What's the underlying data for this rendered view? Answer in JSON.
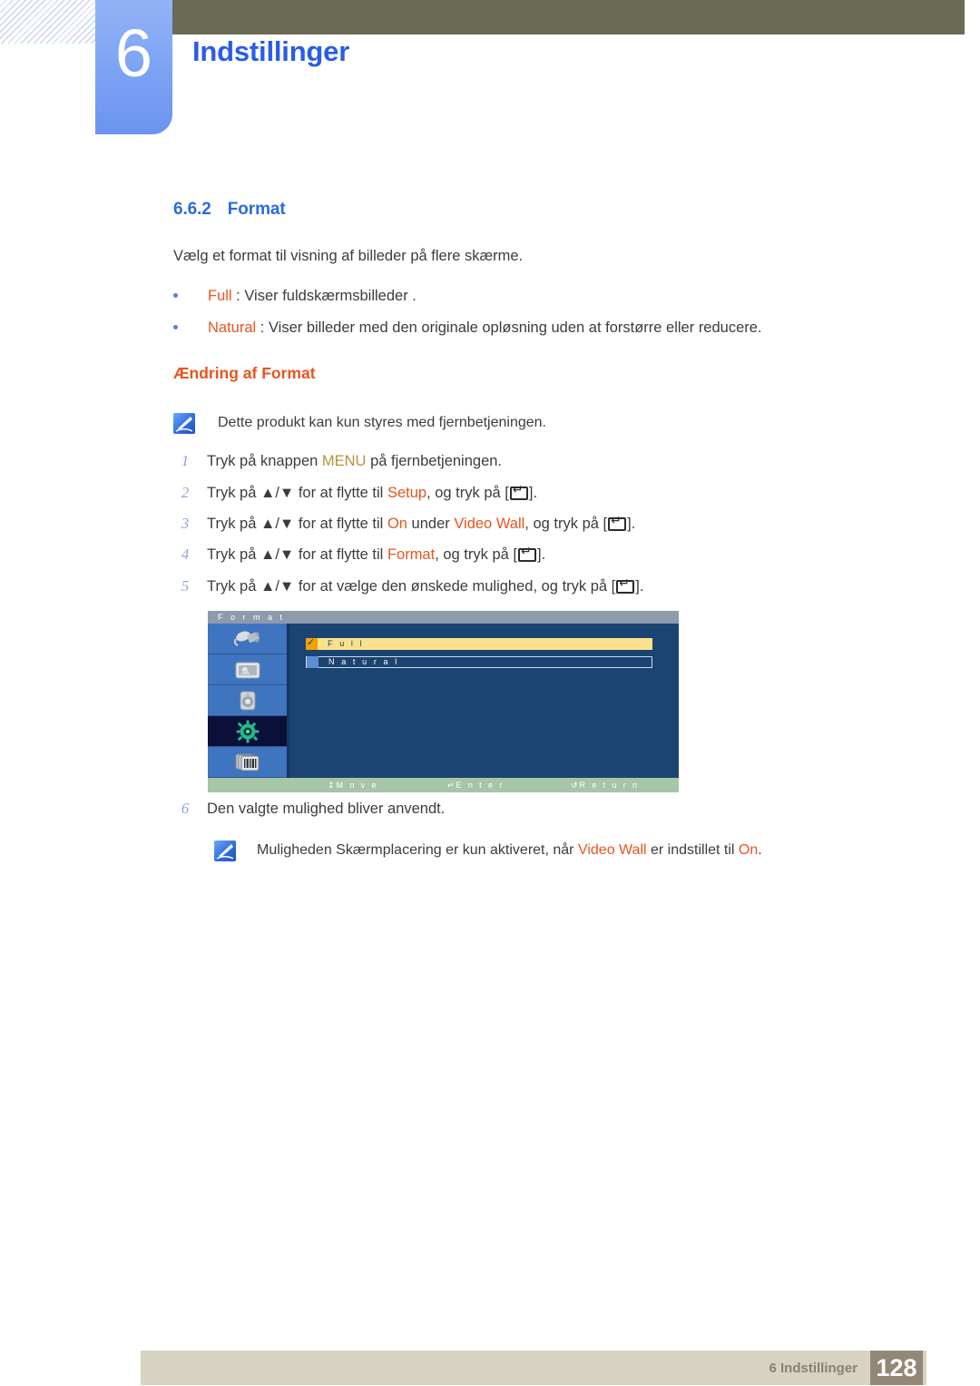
{
  "header": {
    "chapter_number": "6",
    "chapter_title": "Indstillinger"
  },
  "section": {
    "number": "6.6.2",
    "title": "Format",
    "intro": "Vælg et format til visning af billeder på flere skærme.",
    "bullets": [
      {
        "term": "Full",
        "rest": " : Viser fuldskærmsbilleder ."
      },
      {
        "term": "Natural",
        "rest": " : Viser billeder med den originale opløsning uden at forstørre eller reducere."
      }
    ],
    "sub_heading": "Ændring af Format"
  },
  "notes": [
    {
      "icon": "note-pen-icon",
      "text": "Dette produkt kan kun styres med fjernbetjeningen."
    }
  ],
  "note_bottom": {
    "icon": "note-pen-icon",
    "prefix": "Muligheden Skærmplacering er kun aktiveret, når ",
    "highlight1": "Video Wall",
    "middle": " er indstillet til ",
    "highlight2": "On",
    "suffix": "."
  },
  "steps": [
    {
      "num": "1",
      "pre": "Tryk på knappen ",
      "kw": "MENU",
      "kw_color": "gold",
      "post": " på fjernbetjeningen.",
      "has_enter": false
    },
    {
      "num": "2",
      "pre": "Tryk på ▲/▼ for at flytte til ",
      "kw": "Setup",
      "kw_color": "orange",
      "post": ", og tryk på [",
      "has_enter": true,
      "tail": "]."
    },
    {
      "num": "3",
      "pre": "Tryk på ▲/▼ for at flytte til ",
      "kw": "On",
      "kw_color": "orange",
      "mid": " under ",
      "kw2": "Video Wall",
      "post": ", og tryk på [",
      "has_enter": true,
      "tail": "]."
    },
    {
      "num": "4",
      "pre": "Tryk på ▲/▼ for at flytte til ",
      "kw": "Format",
      "kw_color": "orange",
      "post": ", og tryk på [",
      "has_enter": true,
      "tail": "]."
    },
    {
      "num": "5",
      "pre": "Tryk på ▲/▼ for at vælge den ønskede mulighed, og tryk på [",
      "kw": "",
      "post": "",
      "has_enter": true,
      "tail": "]."
    },
    {
      "num": "6",
      "pre": "Den valgte mulighed bliver anvendt.",
      "has_enter": false
    }
  ],
  "osd": {
    "title": "F o r m a t",
    "sidebar": [
      {
        "icon": "input-source-icon",
        "selected": false
      },
      {
        "icon": "picture-icon",
        "selected": false
      },
      {
        "icon": "sound-speaker-icon",
        "selected": false
      },
      {
        "icon": "setup-gear-icon",
        "selected": true
      },
      {
        "icon": "multi-control-icon",
        "selected": false
      }
    ],
    "rows": [
      {
        "label": "F u l l",
        "checked": true,
        "highlighted": true
      },
      {
        "label": "N a t u r a l",
        "checked": false,
        "highlighted": false
      }
    ],
    "footer_hints": [
      {
        "glyph": "↕",
        "label": "M o v e"
      },
      {
        "glyph": "↵",
        "label": "E n t e r"
      },
      {
        "glyph": "↺",
        "label": "R e t u r n"
      }
    ]
  },
  "footer": {
    "label": "6 Indstillinger",
    "page": "128"
  },
  "colors": {
    "accent_blue": "#2b6ae0",
    "accent_orange": "#e8551d",
    "gold": "#b7933a",
    "olive_bar": "#6b6a55",
    "tab_blue": "#7ba2f3",
    "osd_body": "#1c4473",
    "osd_highlight": "#fbe18c",
    "footer_bar": "#d8d3c0",
    "footer_page_box": "#938878"
  }
}
